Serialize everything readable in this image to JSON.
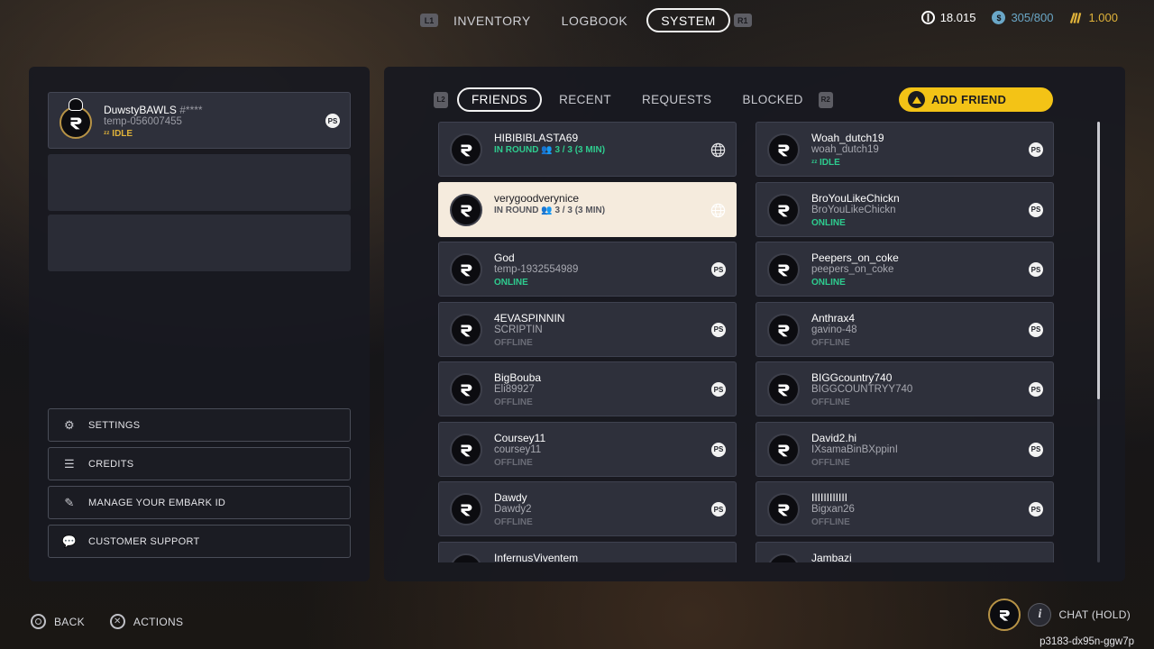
{
  "top_nav": {
    "left_button": "L1",
    "right_button": "R1",
    "tabs": [
      {
        "label": "INVENTORY",
        "active": false
      },
      {
        "label": "LOGBOOK",
        "active": false
      },
      {
        "label": "SYSTEM",
        "active": true
      }
    ]
  },
  "currencies": [
    {
      "icon": "vendor-token-icon",
      "value": "18.015",
      "color": "#ffffff"
    },
    {
      "icon": "tickets-icon",
      "value": "305/800",
      "color": "#6aa7c7"
    },
    {
      "icon": "multibucks-icon",
      "value": "1.000",
      "color": "#e0b33a"
    }
  ],
  "self": {
    "name": "DuwstyBAWLS",
    "tag": "#****",
    "id": "temp-056007455",
    "status": "IDLE",
    "platform": "PS"
  },
  "menu": [
    {
      "label": "SETTINGS",
      "icon": "gear-icon"
    },
    {
      "label": "CREDITS",
      "icon": "credits-list-icon"
    },
    {
      "label": "MANAGE YOUR EMBARK ID",
      "icon": "edit-id-icon"
    },
    {
      "label": "CUSTOMER SUPPORT",
      "icon": "support-chat-icon"
    }
  ],
  "friends_tabs": {
    "left_button": "L2",
    "right_button": "R2",
    "tabs": [
      {
        "label": "FRIENDS",
        "active": true
      },
      {
        "label": "RECENT",
        "active": false
      },
      {
        "label": "REQUESTS",
        "active": false
      },
      {
        "label": "BLOCKED",
        "active": false
      }
    ],
    "add_friend_label": "ADD FRIEND"
  },
  "friends": [
    {
      "name": "HIBIBIBLASTA69",
      "sub": "",
      "status": "IN ROUND",
      "detail": "3 / 3 (3 MIN)",
      "status_color": "#2ecc8f",
      "platform": "globe",
      "selected": false
    },
    {
      "name": "Woah_dutch19",
      "sub": "woah_dutch19",
      "status": "IDLE",
      "detail": "",
      "status_color": "#2ecc8f",
      "platform": "PS",
      "selected": false
    },
    {
      "name": "verygoodverynice",
      "sub": "",
      "status": "IN ROUND",
      "detail": "3 / 3 (3 MIN)",
      "status_color": "#55565d",
      "platform": "globe",
      "selected": true
    },
    {
      "name": "BroYouLikeChickn",
      "sub": "BroYouLikeChickn",
      "status": "ONLINE",
      "detail": "",
      "status_color": "#2ecc8f",
      "platform": "PS",
      "selected": false
    },
    {
      "name": "God",
      "sub": "temp-1932554989",
      "status": "ONLINE",
      "detail": "",
      "status_color": "#2ecc8f",
      "platform": "PS",
      "selected": false
    },
    {
      "name": "Peepers_on_coke",
      "sub": "peepers_on_coke",
      "status": "ONLINE",
      "detail": "",
      "status_color": "#2ecc8f",
      "platform": "PS",
      "selected": false
    },
    {
      "name": "4EVASPINNIN",
      "sub": "SCRIPTIN",
      "status": "OFFLINE",
      "detail": "",
      "status_color": "#6b6d77",
      "platform": "PS",
      "selected": false
    },
    {
      "name": "Anthrax4",
      "sub": "gavino-48",
      "status": "OFFLINE",
      "detail": "",
      "status_color": "#6b6d77",
      "platform": "PS",
      "selected": false
    },
    {
      "name": "BigBouba",
      "sub": "Eli89927",
      "status": "OFFLINE",
      "detail": "",
      "status_color": "#6b6d77",
      "platform": "PS",
      "selected": false
    },
    {
      "name": "BIGGcountry740",
      "sub": "BIGGCOUNTRYY740",
      "status": "OFFLINE",
      "detail": "",
      "status_color": "#6b6d77",
      "platform": "PS",
      "selected": false
    },
    {
      "name": "Coursey11",
      "sub": "coursey11",
      "status": "OFFLINE",
      "detail": "",
      "status_color": "#6b6d77",
      "platform": "PS",
      "selected": false
    },
    {
      "name": "David2.hi",
      "sub": "IXsamaBinBXppinI",
      "status": "OFFLINE",
      "detail": "",
      "status_color": "#6b6d77",
      "platform": "PS",
      "selected": false
    },
    {
      "name": "Dawdy",
      "sub": "Dawdy2",
      "status": "OFFLINE",
      "detail": "",
      "status_color": "#6b6d77",
      "platform": "PS",
      "selected": false
    },
    {
      "name": "IIIIIIIIIIII",
      "sub": "Bigxan26",
      "status": "OFFLINE",
      "detail": "",
      "status_color": "#6b6d77",
      "platform": "PS",
      "selected": false
    },
    {
      "name": "InfernusViventem",
      "sub": "",
      "status": "",
      "detail": "",
      "status_color": "#6b6d77",
      "platform": "PS",
      "selected": false
    },
    {
      "name": "Jambazi",
      "sub": "",
      "status": "",
      "detail": "",
      "status_color": "#6b6d77",
      "platform": "PS",
      "selected": false
    }
  ],
  "bottom": {
    "back_label": "BACK",
    "actions_label": "ACTIONS",
    "chat_label": "CHAT (HOLD)",
    "chat_glyph": "i",
    "client_id": "p3183-dx95n-ggw7p"
  }
}
